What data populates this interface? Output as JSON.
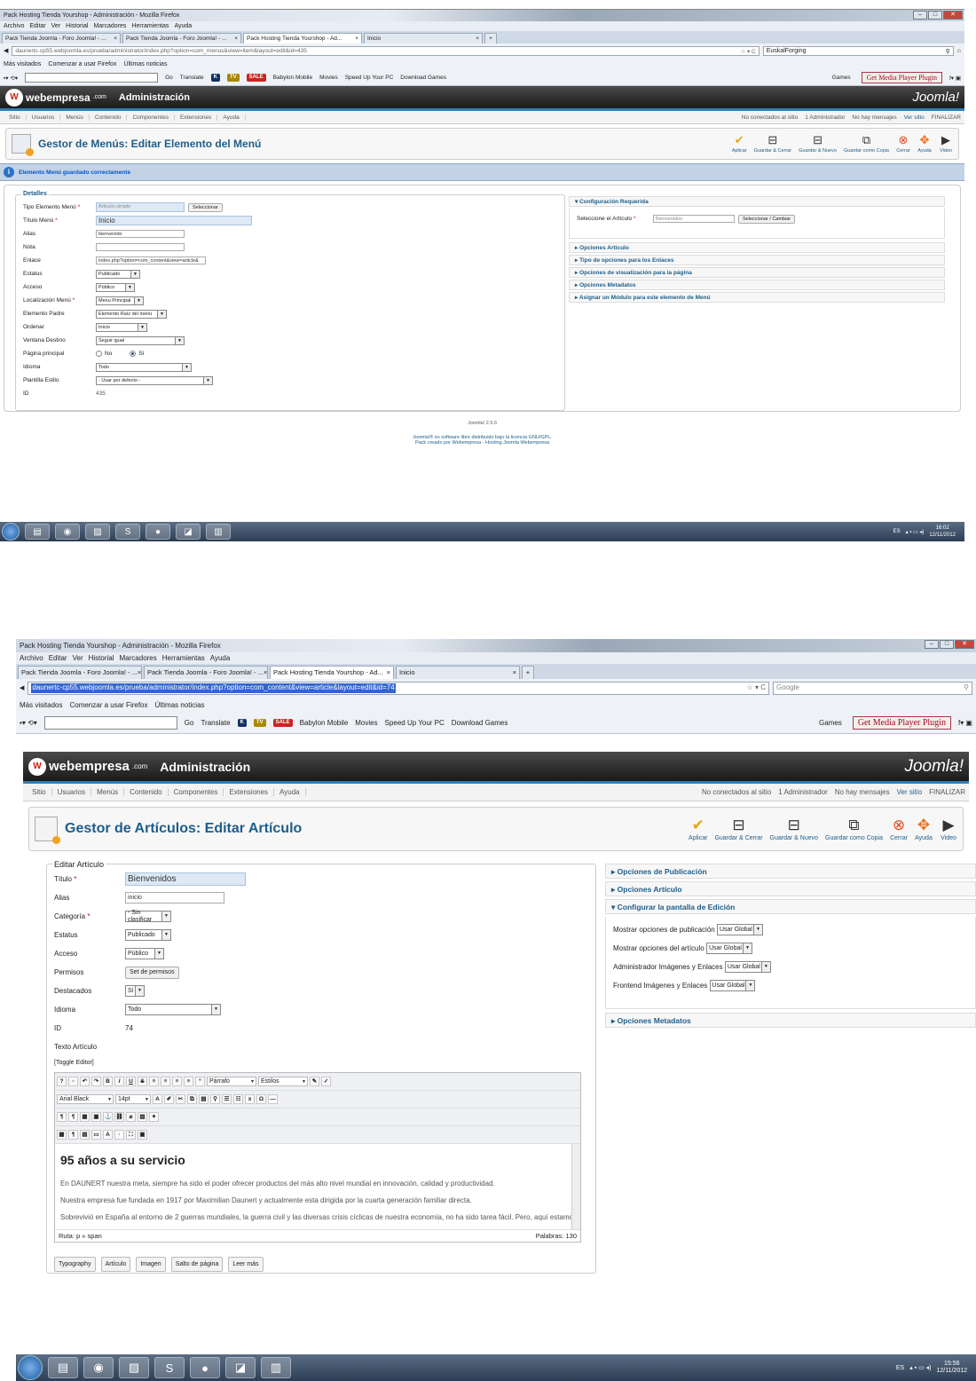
{
  "shot1": {
    "window_title": "Pack Hosting Tienda Yourshop - Administración - Mozilla Firefox",
    "menubar": [
      "Archivo",
      "Editar",
      "Ver",
      "Historial",
      "Marcadores",
      "Herramientas",
      "Ayuda"
    ],
    "tabs": [
      "Pack Tienda Joomla - Foro Joomla! - ...",
      "Pack Tienda Joomla - Foro Joomla! - ...",
      "Pack Hosting Tienda Yourshop - Ad...",
      "Inicio"
    ],
    "url": "daunertc-cp55.webjoomla.es/prueba/administrator/index.php?option=com_menus&view=item&layout=edit&id=435",
    "search": "EuskalForging",
    "bookmarks": [
      "Más visitados",
      "Comenzar a usar Firefox",
      "Últimas noticias"
    ],
    "tools": [
      "Go",
      "Translate",
      "Babylon Mobile",
      "Movies",
      "Speed Up Your PC",
      "Download Games",
      "Games"
    ],
    "get_media": "Get Media Player Plugin",
    "logo": "webempresa",
    "logo_suffix": ".com",
    "admin": "Administración",
    "joomla": "Joomla!",
    "jmenu": [
      "Sitio",
      "Usuarios",
      "Menús",
      "Contenido",
      "Componentes",
      "Extensiones",
      "Ayuda"
    ],
    "status": [
      "No conectados al sitio",
      "1 Administrador",
      "No hay mensajes",
      "Ver sitio",
      "FINALIZAR"
    ],
    "page_title": "Gestor de Menús: Editar Elemento del Menú",
    "toolbar": [
      "Aplicar",
      "Guardar & Cerrar",
      "Guardar & Nuevo",
      "Guardar como Copia",
      "Cerrar",
      "Ayuda",
      "Video"
    ],
    "message": "Elemento Menú guardado correctamente",
    "details_legend": "Detalles",
    "fields": [
      {
        "label": "Tipo Elemento Menú",
        "value": "Artículo simple",
        "btn": "Seleccionar"
      },
      {
        "label": "Título Menú",
        "value": "Inicio"
      },
      {
        "label": "Alias",
        "value": "bienvenido"
      },
      {
        "label": "Nota",
        "value": ""
      },
      {
        "label": "Enlace",
        "value": "index.php?option=com_content&view=article&"
      },
      {
        "label": "Estatus",
        "value": "Publicado"
      },
      {
        "label": "Acceso",
        "value": "Público"
      },
      {
        "label": "Localización Menú",
        "value": "Menu Principal"
      },
      {
        "label": "Elemento Padre",
        "value": "Elemento Raíz del menú"
      },
      {
        "label": "Ordenar",
        "value": "Inicio"
      },
      {
        "label": "Ventana Destino",
        "value": "Seguir igual"
      },
      {
        "label": "Página principal",
        "value": "No",
        "value2": "Sí"
      },
      {
        "label": "Idioma",
        "value": "Todo"
      },
      {
        "label": "Plantilla Estilo",
        "value": "- Usar por defecto -"
      },
      {
        "label": "ID",
        "value": "435"
      }
    ],
    "right_panel_title": "Configuración Requerida",
    "right_panel_label": "Seleccione el Artículo",
    "right_panel_value": "Bienvenidos",
    "right_panel_btn": "Seleccionar / Cambiar",
    "panels": [
      "Opciones Artículo",
      "Tipo de opciones para los Enlaces",
      "Opciones de visualización para la página",
      "Opciones Metadatos",
      "Asignar un Módulo para este elemento de Menú"
    ],
    "footer_version": "Joomla! 2.5.6",
    "footer_line1": "Joomla!® es software libre distribuido bajo la licencia GNU/GPL.",
    "footer_line2": "Pack creado por Webempresa - Hosting Joomla Webempresa",
    "tray_lang": "ES",
    "clock_time": "16:02",
    "clock_date": "12/11/2012"
  },
  "shot2": {
    "window_title": "Pack Hosting Tienda Yourshop - Administración - Mozilla Firefox",
    "url": "daunertc-cp55.webjoomla.es/prueba/administrator/index.php?option=com_content&view=article&layout=edit&id=74",
    "search": "Google",
    "page_title": "Gestor de Artículos: Editar Artículo",
    "legend": "Editar Artículo",
    "fields": [
      {
        "label": "Título",
        "value": "Bienvenidos"
      },
      {
        "label": "Alias",
        "value": "inicio"
      },
      {
        "label": "Categoría",
        "value": "- Sin clasificar"
      },
      {
        "label": "Estatus",
        "value": "Publicado"
      },
      {
        "label": "Acceso",
        "value": "Público"
      },
      {
        "label": "Permisos",
        "value": "Set de permisos"
      },
      {
        "label": "Destacados",
        "value": "Sí"
      },
      {
        "label": "Idioma",
        "value": "Todo"
      },
      {
        "label": "ID",
        "value": "74"
      },
      {
        "label": "Texto Artículo",
        "value": ""
      }
    ],
    "toggle_editor": "[Toggle Editor]",
    "editor_format": "Párrafo",
    "editor_styles": "Estilos",
    "editor_font": "Arial Black",
    "editor_size": "14pt",
    "editor_heading": "95 años a su servicio",
    "editor_p1": "En DAUNERT nuestra meta, siempre ha sido el poder ofrecer productos del más alto nivel mundial en innovación, calidad y productividad.",
    "editor_p2": "Nuestra empresa fue fundada en 1917 por Maximilian Daunert y actualmente esta dirigida por la cuarta generación familiar directa.",
    "editor_p3": "Sobrevivió en España al entorno de 2 guerras mundiales, la guerra civil y las diversas crisis cíclicas de nuestra economía, no ha sido tarea fácil. Pero, aquí estamos, con el",
    "path": "Ruta:  p » span",
    "words": "Palabras: 130",
    "editor_buttons": [
      "Typography",
      "Artículo",
      "Imagen",
      "Salto de página",
      "Leer más"
    ],
    "panels": [
      "Opciones de Publicación",
      "Opciones Artículo",
      "Configurar la pantalla de Edición",
      "Opciones Metadatos"
    ],
    "edit_options": [
      {
        "label": "Mostrar opciones de publicación",
        "value": "Usar Global"
      },
      {
        "label": "Mostrar opciones del artículo",
        "value": "Usar Global"
      },
      {
        "label": "Administrador Imágenes y Enlaces",
        "value": "Usar Global"
      },
      {
        "label": "Frontend Imágenes y Enlaces",
        "value": "Usar Global"
      }
    ],
    "clock_time": "15:56",
    "clock_date": "12/11/2012"
  }
}
